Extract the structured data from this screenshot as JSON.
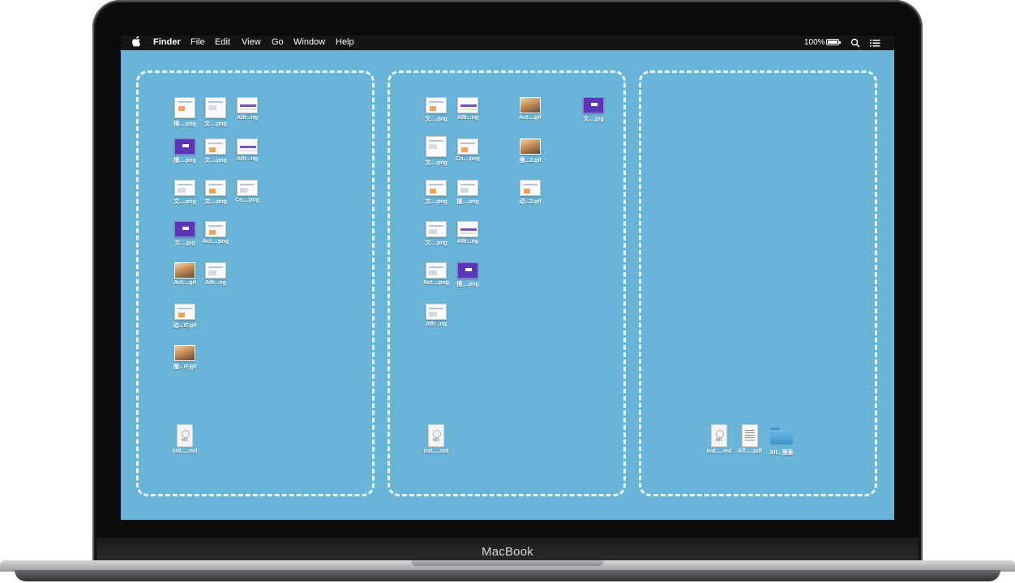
{
  "device": {
    "brand": "MacBook"
  },
  "menubar": {
    "app": "Finder",
    "items": [
      "File",
      "Edit",
      "View",
      "Go",
      "Window",
      "Help"
    ],
    "battery": "100%",
    "icons": [
      "apple-icon",
      "battery-icon",
      "search-icon",
      "list-icon"
    ]
  },
  "panels": [
    {
      "icons": [
        "搜....png",
        "文....png",
        "Alfr...ng",
        "搜....png",
        "文....png",
        "Alfr...ng",
        "文....png",
        "文....png",
        "Co....png",
        "文....jpg",
        "Act....png",
        "Act....gif",
        "Alfr...ng",
        "动...IF.gif",
        "搜...IF.gif"
      ],
      "bottom": [
        "ind.....md"
      ]
    },
    {
      "icons": [
        "文....png",
        "Alfr...ng",
        "Act....gif",
        "文....jpg",
        "文....png",
        "Co....png",
        "搜...2.gif",
        "文....png",
        "搜....png",
        "动...2.gif",
        "文....png",
        "Alfr...ng",
        "Act....png",
        "搜....png",
        "Alfr...ng"
      ],
      "bottom": [
        "ind.....md"
      ]
    },
    {
      "icons": [],
      "bottom": [
        "ind.....md",
        "Alf.....pdf",
        "Alf...搜索"
      ]
    }
  ]
}
